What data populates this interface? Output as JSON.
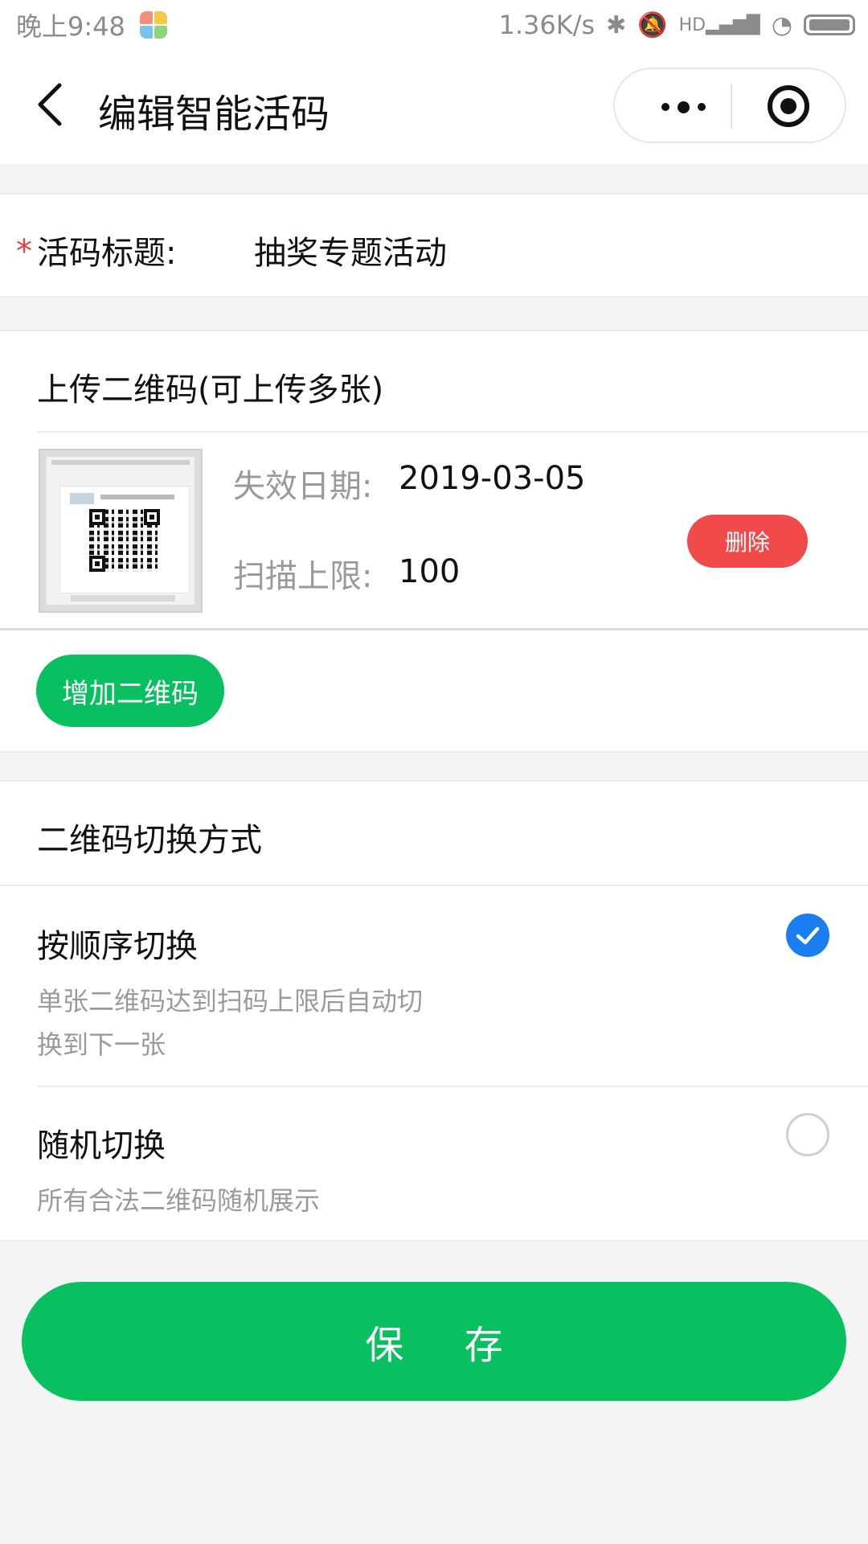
{
  "status_bar": {
    "time": "晚上9:48",
    "speed": "1.36K/s",
    "hd": "HD"
  },
  "nav": {
    "title": "编辑智能活码"
  },
  "form": {
    "required_mark": "*",
    "title_label": "活码标题:",
    "title_value": "抽奖专题活动"
  },
  "upload": {
    "heading": "上传二维码(可上传多张)",
    "items": [
      {
        "expire_label": "失效日期:",
        "expire_value": "2019-03-05",
        "limit_label": "扫描上限:",
        "limit_value": "100",
        "delete_label": "删除"
      }
    ],
    "add_label": "增加二维码"
  },
  "switch_mode": {
    "heading": "二维码切换方式",
    "options": [
      {
        "title": "按顺序切换",
        "desc": "单张二维码达到扫码上限后自动切换到下一张",
        "selected": true
      },
      {
        "title": "随机切换",
        "desc": "所有合法二维码随机展示",
        "selected": false
      }
    ]
  },
  "save_label": "保 存",
  "colors": {
    "accent_green": "#08c060",
    "delete_red": "#f24a4a",
    "radio_blue": "#1a7df2",
    "required_red": "#f03c3c"
  }
}
